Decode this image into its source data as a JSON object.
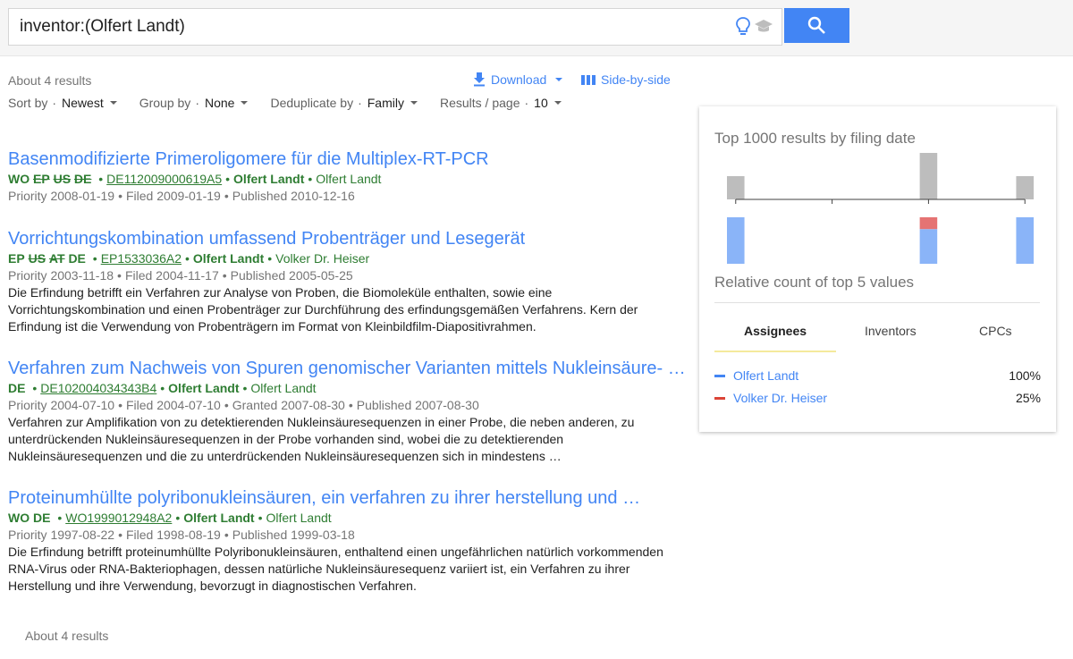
{
  "search": {
    "query": "inventor:(Olfert Landt)"
  },
  "toolbar": {
    "result_count": "About 4 results",
    "download_label": "Download",
    "side_by_side_label": "Side-by-side"
  },
  "sort": {
    "sort_by_label": "Sort by",
    "sort_by_value": "Newest",
    "group_by_label": "Group by",
    "group_by_value": "None",
    "dedupe_label": "Deduplicate by",
    "dedupe_value": "Family",
    "per_page_label": "Results / page",
    "per_page_value": "10"
  },
  "results": [
    {
      "title": "Basenmodifizierte Primeroligomere für die Multiplex-RT-PCR",
      "countries": [
        {
          "code": "WO",
          "strike": false
        },
        {
          "code": "EP",
          "strike": true
        },
        {
          "code": "US",
          "strike": true
        },
        {
          "code": "DE",
          "strike": true
        }
      ],
      "pubnum": "DE112009000619A5",
      "assignee": "Olfert Landt",
      "inventor": "Olfert Landt",
      "dates": [
        "Priority 2008-01-19",
        "Filed 2009-01-19",
        "Published 2010-12-16"
      ],
      "snippet": ""
    },
    {
      "title": "Vorrichtungskombination umfassend Probenträger und Lesegerät",
      "countries": [
        {
          "code": "EP",
          "strike": false
        },
        {
          "code": "US",
          "strike": true
        },
        {
          "code": "AT",
          "strike": true
        },
        {
          "code": "DE",
          "strike": false
        }
      ],
      "pubnum": "EP1533036A2",
      "assignee": "Olfert Landt",
      "inventor": "Volker Dr. Heiser",
      "dates": [
        "Priority 2003-11-18",
        "Filed 2004-11-17",
        "Published 2005-05-25"
      ],
      "snippet": "Die Erfindung betrifft ein Verfahren zur Analyse von Proben, die Biomoleküle enthalten, sowie eine Vorrichtungskombination und einen Probenträger zur Durchführung des erfindungsgemäßen Verfahrens. Kern der Erfindung ist die Verwendung von Probenträgern im Format von Kleinbildfilm-Diapositivrahmen."
    },
    {
      "title": "Verfahren zum Nachweis von Spuren genomischer Varianten mittels Nukleinsäure- …",
      "countries": [
        {
          "code": "DE",
          "strike": false
        }
      ],
      "pubnum": "DE102004034343B4",
      "assignee": "Olfert Landt",
      "inventor": "Olfert Landt",
      "dates": [
        "Priority 2004-07-10",
        "Filed 2004-07-10",
        "Granted 2007-08-30",
        "Published 2007-08-30"
      ],
      "snippet": "Verfahren zur Amplifikation von zu detektierenden Nukleinsäuresequenzen in einer Probe, die neben anderen, zu unterdrückenden Nukleinsäuresequenzen in der Probe vorhanden sind, wobei die zu detektierenden Nukleinsäuresequenzen und die zu unterdrückenden Nukleinsäuresequenzen sich in mindestens …"
    },
    {
      "title": "Proteinumhüllte polyribonukleinsäuren, ein verfahren zu ihrer herstellung und …",
      "countries": [
        {
          "code": "WO",
          "strike": false
        },
        {
          "code": "DE",
          "strike": false
        }
      ],
      "pubnum": "WO1999012948A2",
      "assignee": "Olfert Landt",
      "inventor": "Olfert Landt",
      "dates": [
        "Priority 1997-08-22",
        "Filed 1998-08-19",
        "Published 1999-03-18"
      ],
      "snippet": "Die Erfindung betrifft proteinumhüllte Polyribonukleinsäuren, enthaltend einen ungefährlichen natürlich vorkommenden RNA-Virus oder RNA-Bakteriophagen, dessen natürliche Nukleinsäuresequenz variiert ist, ein Verfahren zu ihrer Herstellung und ihre Verwendung, bevorzugt in diagnostischen Verfahren."
    }
  ],
  "footer": {
    "result_count": "About 4 results"
  },
  "panel": {
    "title": "Top 1000 results by filing date",
    "subtitle": "Relative count of top 5 values",
    "tabs": [
      {
        "label": "Assignees",
        "active": true
      },
      {
        "label": "Inventors",
        "active": false
      },
      {
        "label": "CPCs",
        "active": false
      }
    ],
    "legend": [
      {
        "name": "Olfert Landt",
        "percent": "100%",
        "color": "#4285f4"
      },
      {
        "name": "Volker Dr. Heiser",
        "percent": "25%",
        "color": "#db4437"
      }
    ]
  },
  "chart_data": {
    "type": "bar",
    "title": "Top 1000 results by filing date",
    "filing_counts": [
      1,
      0,
      0,
      0,
      0,
      0,
      0,
      0,
      0,
      0,
      2,
      0,
      0,
      0,
      0,
      1
    ],
    "relative_counts": {
      "bins": [
        0,
        10,
        15
      ],
      "series": [
        {
          "name": "Olfert Landt",
          "values": [
            1,
            1,
            1
          ]
        },
        {
          "name": "Volker Dr. Heiser",
          "values": [
            0,
            0.34,
            0
          ]
        }
      ]
    },
    "colors": {
      "filing": "#bdbdbd",
      "blue": "#8ab4f8",
      "red": "#e57373"
    },
    "ylim": [
      0,
      2
    ]
  }
}
